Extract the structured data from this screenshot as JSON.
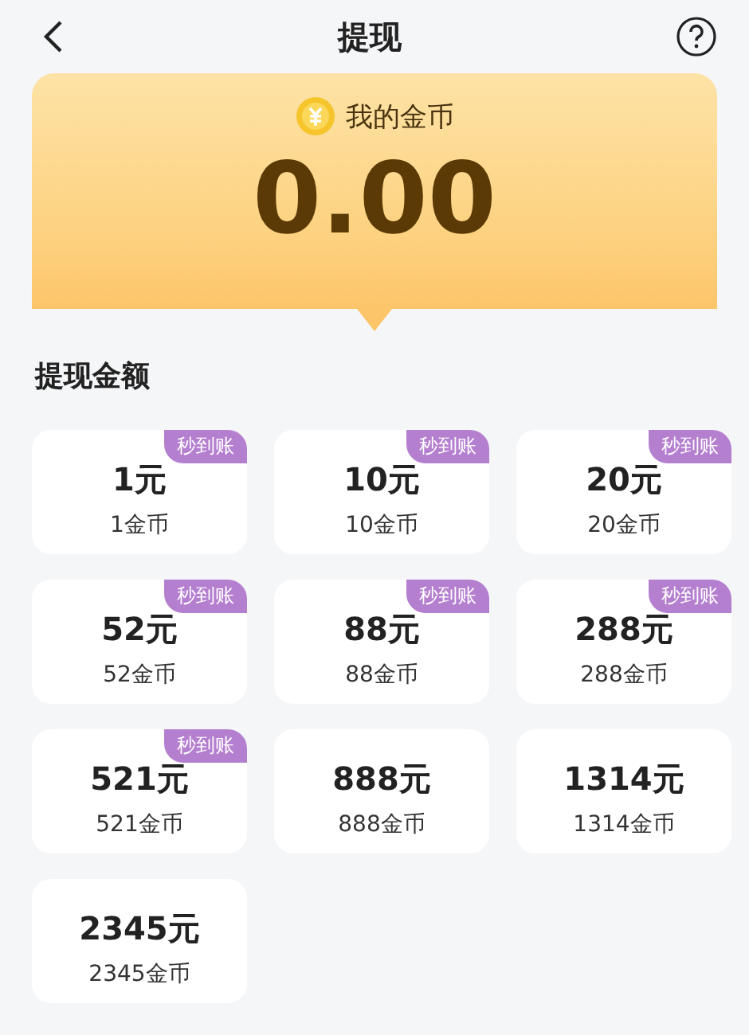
{
  "header": {
    "title": "提现"
  },
  "balance": {
    "label": "我的金币",
    "amount": "0.00"
  },
  "section_title": "提现金额",
  "options": [
    {
      "amount": "1元",
      "coins": "1金币",
      "badge": "秒到账"
    },
    {
      "amount": "10元",
      "coins": "10金币",
      "badge": "秒到账"
    },
    {
      "amount": "20元",
      "coins": "20金币",
      "badge": "秒到账"
    },
    {
      "amount": "52元",
      "coins": "52金币",
      "badge": "秒到账"
    },
    {
      "amount": "88元",
      "coins": "88金币",
      "badge": "秒到账"
    },
    {
      "amount": "288元",
      "coins": "288金币",
      "badge": "秒到账"
    },
    {
      "amount": "521元",
      "coins": "521金币",
      "badge": "秒到账"
    },
    {
      "amount": "888元",
      "coins": "888金币"
    },
    {
      "amount": "1314元",
      "coins": "1314金币"
    },
    {
      "amount": "2345元",
      "coins": "2345金币"
    }
  ]
}
